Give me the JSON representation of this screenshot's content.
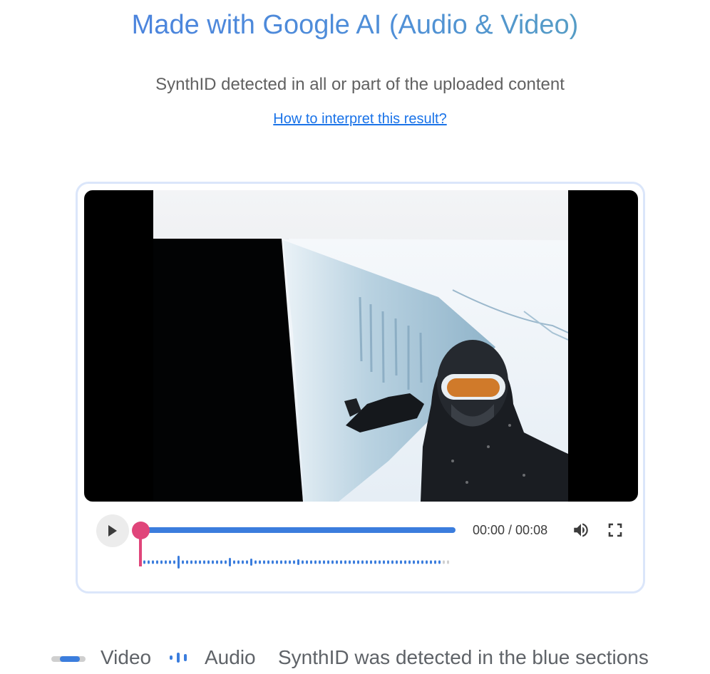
{
  "header": {
    "title": "Made with Google AI (Audio & Video)",
    "subtitle": "SynthID detected in all or part of the uploaded content",
    "help_link": "How to interpret this result?"
  },
  "player": {
    "time": "00:00 / 00:08",
    "progress": 0.0,
    "video_detected_fraction": 1.0
  },
  "legend": {
    "video_label": "Video",
    "audio_label": "Audio",
    "note": "SynthID was detected in the blue sections"
  },
  "colors": {
    "accent_blue": "#3b7ddd",
    "scrubber_pink": "#e0457a",
    "undetected_gray": "#cfcfcf",
    "card_border": "#dbe6fa"
  },
  "icons": {
    "play": "play-icon",
    "volume": "volume-icon",
    "fullscreen": "fullscreen-icon"
  }
}
